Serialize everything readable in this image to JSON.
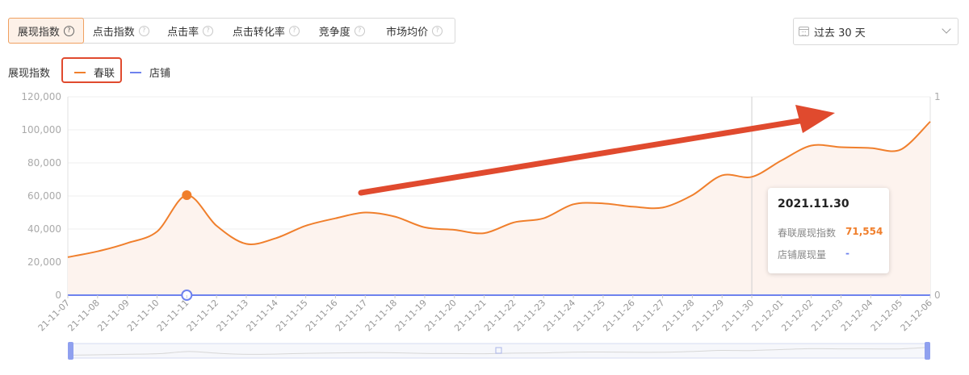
{
  "tabs": [
    {
      "label": "展现指数",
      "active": true
    },
    {
      "label": "点击指数",
      "active": false
    },
    {
      "label": "点击率",
      "active": false
    },
    {
      "label": "点击转化率",
      "active": false
    },
    {
      "label": "竞争度",
      "active": false
    },
    {
      "label": "市场均价",
      "active": false
    }
  ],
  "help_glyph": "?",
  "date_range": {
    "label": "过去 30 天",
    "icon": "calendar-icon"
  },
  "legend": {
    "title": "展现指数",
    "items": [
      {
        "name": "春联",
        "color": "#f07f2c"
      },
      {
        "name": "店铺",
        "color": "#6e82ee"
      }
    ]
  },
  "tooltip": {
    "date": "2021.11.30",
    "rows": [
      {
        "label": "春联展现指数",
        "value": "71,554",
        "color": "#f07f2c"
      },
      {
        "label": "店铺展现量",
        "value": "-",
        "color": "#6e82ee"
      }
    ]
  },
  "chart_data": {
    "type": "line",
    "x": [
      "21-11-07",
      "21-11-08",
      "21-11-09",
      "21-11-10",
      "21-11-11",
      "21-11-12",
      "21-11-13",
      "21-11-14",
      "21-11-15",
      "21-11-16",
      "21-11-17",
      "21-11-18",
      "21-11-19",
      "21-11-20",
      "21-11-21",
      "21-11-22",
      "21-11-23",
      "21-11-24",
      "21-11-25",
      "21-11-26",
      "21-11-27",
      "21-11-28",
      "21-11-29",
      "21-11-30",
      "21-12-01",
      "21-12-02",
      "21-12-03",
      "21-12-04",
      "21-12-05",
      "21-12-06"
    ],
    "series": [
      {
        "name": "春联",
        "axis": "left",
        "color": "#f07f2c",
        "values": [
          23000,
          26500,
          31500,
          38500,
          60500,
          42000,
          31000,
          34500,
          42000,
          46500,
          50000,
          47500,
          41000,
          39500,
          37500,
          44000,
          46500,
          55000,
          55500,
          53500,
          53000,
          60500,
          72500,
          71554,
          81500,
          90500,
          89500,
          89000,
          88000,
          105000
        ]
      },
      {
        "name": "店铺",
        "axis": "right",
        "color": "#6e82ee",
        "values": [
          0,
          0,
          0,
          0,
          0,
          0,
          0,
          0,
          0,
          0,
          0,
          0,
          0,
          0,
          0,
          0,
          0,
          0,
          0,
          0,
          0,
          0,
          0,
          0,
          0,
          0,
          0,
          0,
          0,
          0
        ]
      }
    ],
    "y_left": {
      "ticks": [
        "0",
        "20,000",
        "40,000",
        "60,000",
        "80,000",
        "100,000",
        "120,000"
      ],
      "range": [
        0,
        120000
      ]
    },
    "y_right": {
      "ticks": [
        "0",
        "1"
      ],
      "range": [
        0,
        1
      ]
    },
    "highlighted_points": [
      "21-11-11"
    ],
    "hover_x": "21-11-30",
    "annotation": "rising trend arrow",
    "grid": true,
    "area_fill": true
  }
}
